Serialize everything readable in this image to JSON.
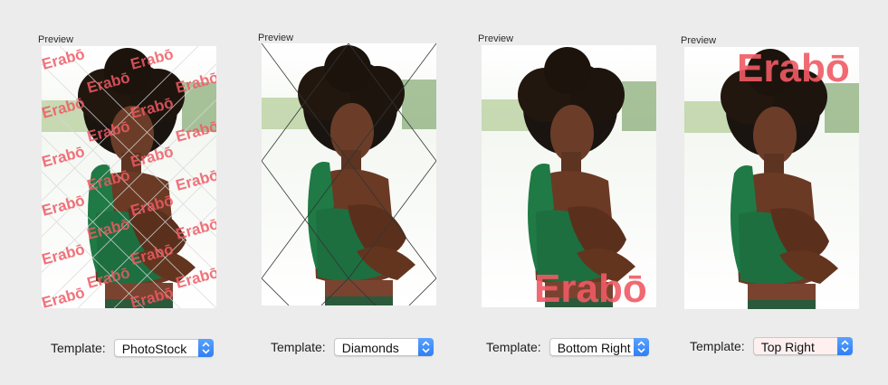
{
  "brand": {
    "watermark_text": "Erabō",
    "watermark_color": "#f05a64"
  },
  "panels": [
    {
      "preview_label": "Preview",
      "template_label": "Template:",
      "template_value": "PhotoStock",
      "style": "photostock"
    },
    {
      "preview_label": "Preview",
      "template_label": "Template:",
      "template_value": "Diamonds",
      "style": "diamonds"
    },
    {
      "preview_label": "Preview",
      "template_label": "Template:",
      "template_value": "Bottom Right",
      "style": "bottom-right"
    },
    {
      "preview_label": "Preview",
      "template_label": "Template:",
      "template_value": "Top Right",
      "style": "top-right"
    }
  ],
  "icons": {
    "popup_arrows": "chevron-up-down-icon"
  },
  "colors": {
    "window_bg": "#ececec",
    "accent": "#3b86f7",
    "shirt": "#1f7a45"
  }
}
